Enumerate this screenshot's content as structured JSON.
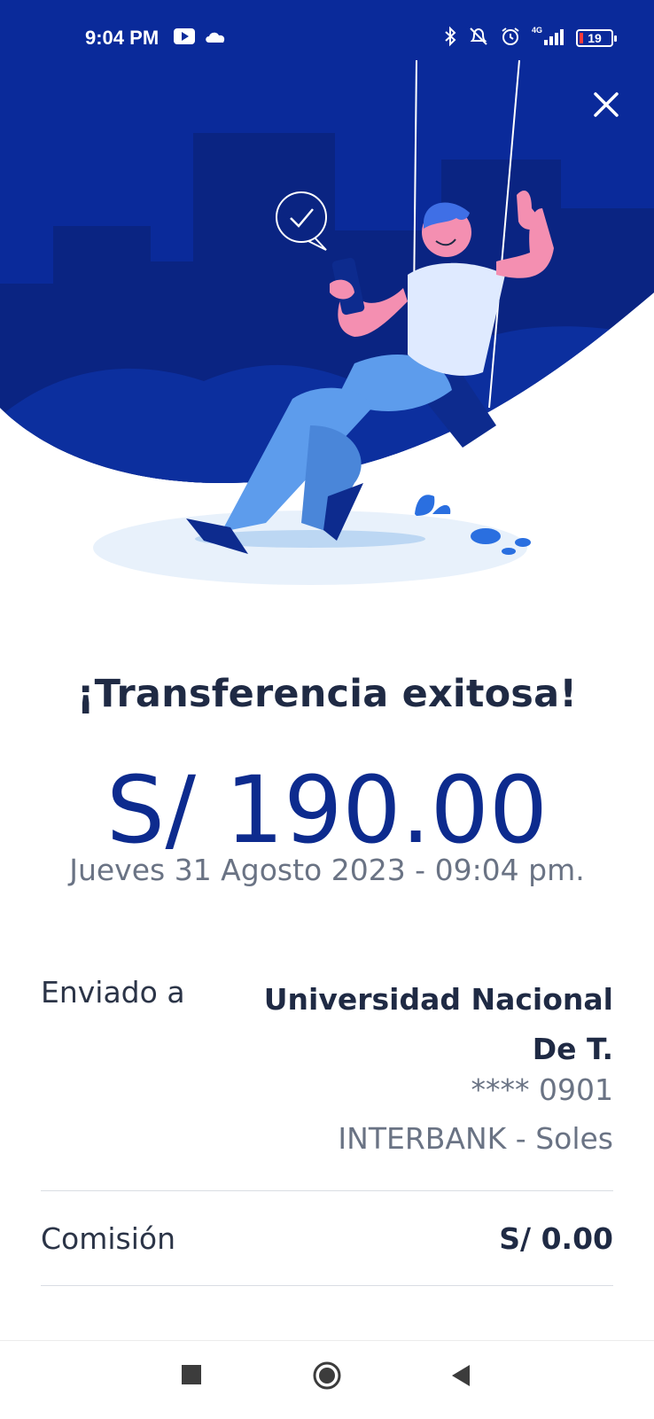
{
  "status_bar": {
    "time": "9:04 PM",
    "icons_left": [
      "youtube-icon",
      "cloud-icon"
    ],
    "icons_right": [
      "bluetooth-icon",
      "bell-off-icon",
      "alarm-icon",
      "signal-4g-icon",
      "battery-icon"
    ],
    "network": "4G",
    "battery_level": "19"
  },
  "header": {
    "close_icon": "close-icon"
  },
  "colors": {
    "hero_background": "#0a2a9a",
    "building_shade": "#0a2482",
    "hill_shade": "#0c2f9e",
    "amount_color": "#0d2b8e",
    "title_color": "#1f2a44",
    "muted_text": "#6a7384"
  },
  "receipt": {
    "title": "¡Transferencia exitosa!",
    "amount": "S/ 190.00",
    "date": "Jueves 31 Agosto 2023 - 09:04 pm.",
    "sent_to_label": "Enviado a",
    "recipient_name": "Universidad Nacional De T.",
    "account_masked": "**** 0901",
    "bank_currency": "INTERBANK - Soles",
    "commission_label": "Comisión",
    "commission_value": "S/ 0.00"
  },
  "nav_bar": {
    "buttons": [
      "recent-apps-button",
      "home-button",
      "back-button"
    ]
  }
}
